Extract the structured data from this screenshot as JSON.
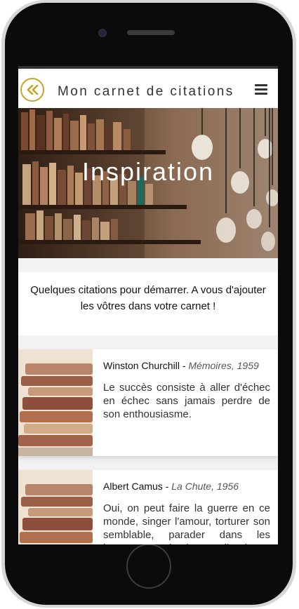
{
  "app": {
    "title": "Mon carnet de citations"
  },
  "hero": {
    "title": "Inspiration"
  },
  "intro": {
    "text": "Quelques citations pour démarrer. A vous d'ajouter les vôtres dans votre carnet !"
  },
  "quotes": [
    {
      "author": "Winston Churchill",
      "separator": " - ",
      "source": "Mémoires, 1959",
      "text": "Le succès consiste à aller d'échec en échec sans jamais perdre de son enthousiasme."
    },
    {
      "author": "Albert Camus",
      "separator": " - ",
      "source": "La Chute, 1956",
      "text": "Oui, on peut faire la guerre en ce monde, singer l'amour, torturer son semblable, parader dans les journaux, ou simplement dire du"
    }
  ],
  "colors": {
    "accent": "#c9a227",
    "text": "#333333",
    "background": "#f2f2f2"
  },
  "icons": [
    "double-chevron-left-icon",
    "hamburger-menu-icon"
  ]
}
